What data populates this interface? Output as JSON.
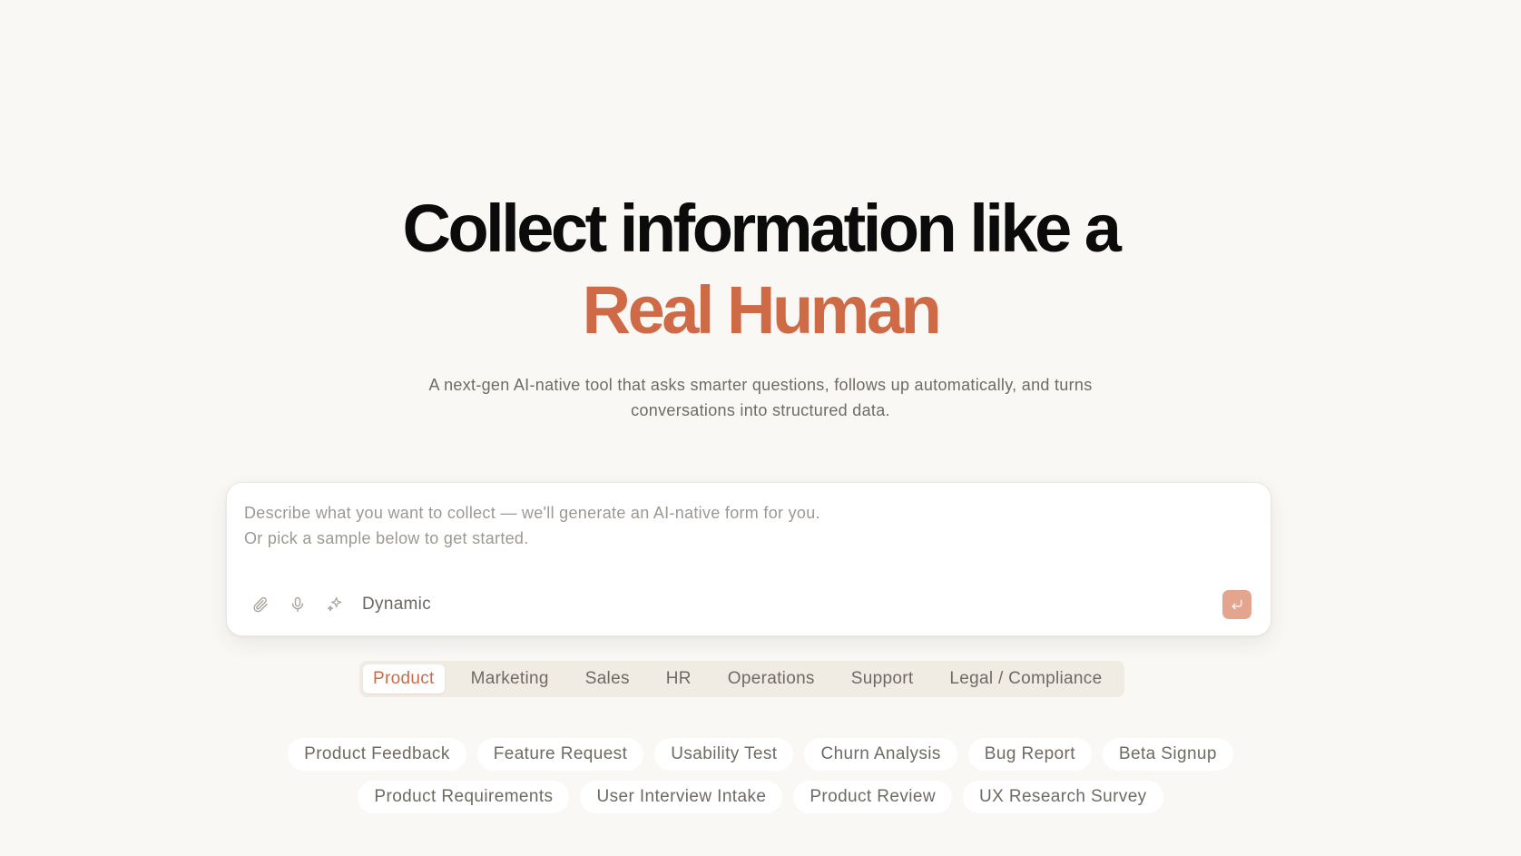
{
  "hero": {
    "title_line1": "Collect information like a",
    "title_line2": "Real Human",
    "subtitle_line1": "A next-gen AI-native tool that asks smarter questions, follows up automatically, and turns",
    "subtitle_line2": "conversations into structured data."
  },
  "composer": {
    "placeholder_line1": "Describe what you want to collect — we'll generate an AI-native form for you.",
    "placeholder_line2": "Or pick a sample below to get started.",
    "mode_label": "Dynamic",
    "icons": [
      "paperclip-icon",
      "microphone-icon",
      "sparkle-icon",
      "enter-icon"
    ]
  },
  "categories": {
    "active": "Product",
    "tabs": [
      "Product",
      "Marketing",
      "Sales",
      "HR",
      "Operations",
      "Support",
      "Legal / Compliance"
    ]
  },
  "samples": {
    "row1": [
      "Product Feedback",
      "Feature Request",
      "Usability Test",
      "Churn Analysis",
      "Bug Report",
      "Beta Signup"
    ],
    "row2": [
      "Product Requirements",
      "User Interview Intake",
      "Product Review",
      "UX Research Survey"
    ]
  },
  "colors": {
    "background": "#f9f8f5",
    "accent": "#cf6a47",
    "send_button": "#e4a58f",
    "tab_bar": "#f0ebe3"
  }
}
